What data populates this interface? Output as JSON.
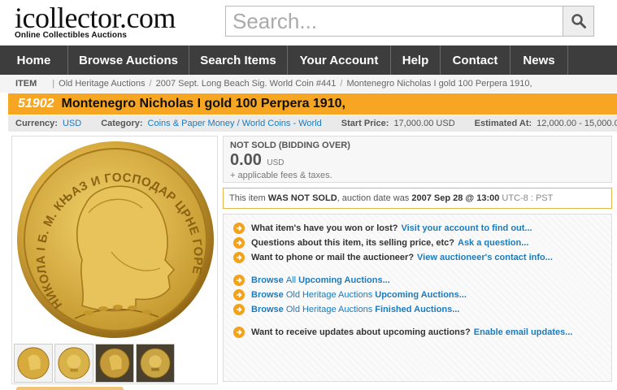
{
  "header": {
    "logo_main": "icollector.com",
    "logo_sub": "Online Collectibles Auctions",
    "search_placeholder": "Search..."
  },
  "nav": [
    {
      "label": "Home"
    },
    {
      "label": "Browse Auctions"
    },
    {
      "label": "Search Items"
    },
    {
      "label": "Your Account"
    },
    {
      "label": "Help"
    },
    {
      "label": "Contact"
    },
    {
      "label": "News"
    }
  ],
  "breadcrumb": {
    "label": "ITEM",
    "items": [
      "Old Heritage Auctions",
      "2007 Sept. Long Beach Sig. World Coin #441",
      "Montenegro Nicholas I gold 100 Perpera 1910,"
    ]
  },
  "lot": {
    "number": "51902",
    "title": "Montenegro Nicholas I gold 100 Perpera 1910,"
  },
  "info": {
    "currency_label": "Currency:",
    "currency": "USD",
    "category_label": "Category:",
    "category": "Coins & Paper Money / World Coins - World",
    "start_label": "Start Price:",
    "start_price": "17,000.00 USD",
    "estimate_label": "Estimated At:",
    "estimate": "12,000.00 - 15,000.00 U"
  },
  "status": {
    "title": "NOT SOLD (BIDDING OVER)",
    "price": "0.00",
    "currency": "USD",
    "fees": "+ applicable fees & taxes."
  },
  "notice": {
    "prefix": "This item",
    "strong": "WAS NOT SOLD",
    "mid": ", auction date was",
    "date": "2007 Sep 28 @ 13:00",
    "tz": "UTC-8 : PST"
  },
  "actions": {
    "won_text": "What item's have you won or lost?",
    "won_link": "Visit your account to find out...",
    "question_text": "Questions about this item, its selling price, etc?",
    "question_link": "Ask a question...",
    "phone_text": "Want to phone or mail the auctioneer?",
    "phone_link": "View auctioneer's contact info...",
    "browse_all_a": "Browse",
    "browse_all_b": "All",
    "browse_all_c": "Upcoming Auctions...",
    "browse_up_a": "Browse",
    "browse_up_b": "Old Heritage Auctions",
    "browse_up_c": "Upcoming Auctions...",
    "browse_fin_a": "Browse",
    "browse_fin_b": "Old Heritage Auctions",
    "browse_fin_c": "Finished Auctions...",
    "updates_text": "Want to receive updates about upcoming auctions?",
    "updates_link": "Enable email updates..."
  },
  "coin": {
    "legend_top": "НИКОЛА I Б. М. КЊАЗ И ГОСПОДАР ЦРНЕ ГОРЕ"
  },
  "colors": {
    "orange": "#f6a623",
    "nav_bg": "#3d3d3d",
    "link": "#1b7bbd"
  }
}
